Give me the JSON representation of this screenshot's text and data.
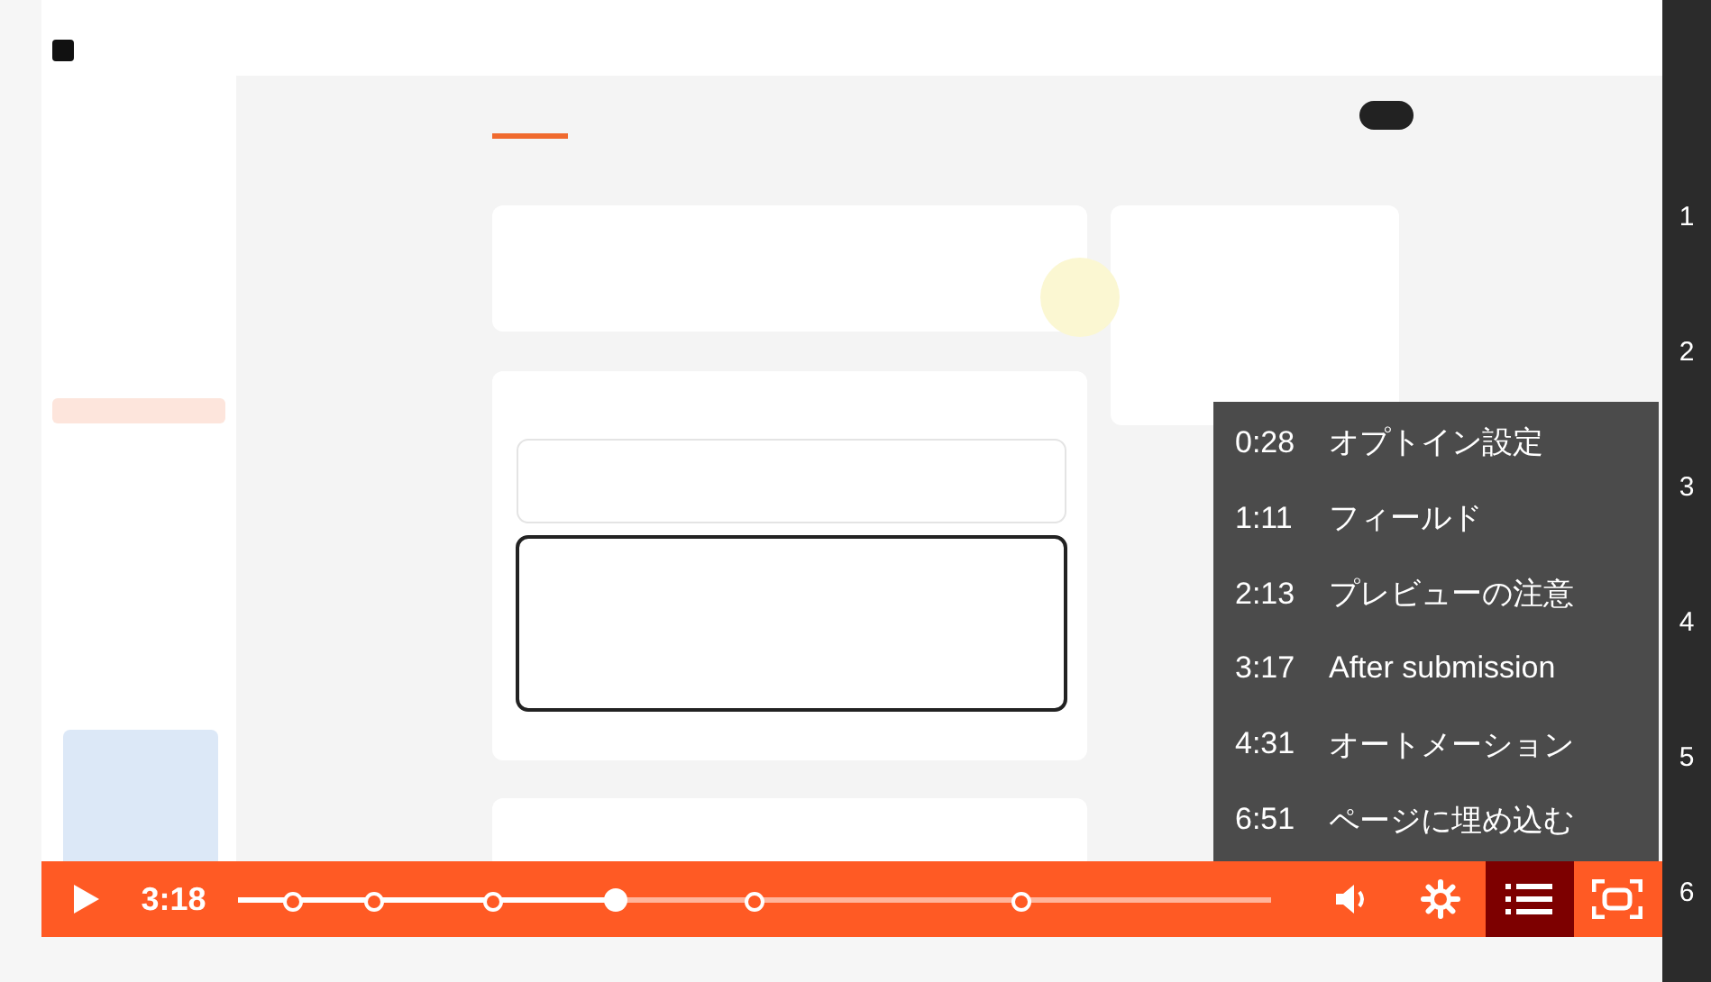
{
  "player": {
    "current_time": "3:18",
    "level": 0.365,
    "chapters_open": true
  },
  "chapters": [
    {
      "time": "0:28",
      "title": "オプトイン設定"
    },
    {
      "time": "1:11",
      "title": "フィールド"
    },
    {
      "time": "2:13",
      "title": "プレビューの注意"
    },
    {
      "time": "3:17",
      "title": "After submission"
    },
    {
      "time": "4:31",
      "title": "オートメーション"
    },
    {
      "time": "6:51",
      "title": "ページに埋め込む"
    }
  ],
  "side_numbers": [
    "1",
    "2",
    "3",
    "4",
    "5",
    "6"
  ]
}
